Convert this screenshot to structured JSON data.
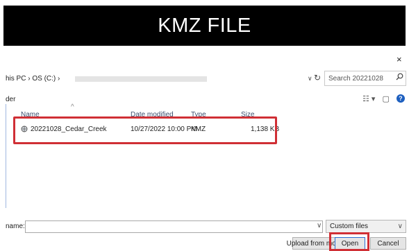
{
  "banner": {
    "title": "KMZ FILE"
  },
  "dialog": {
    "close_glyph": "×",
    "address_bar": {
      "path_text": "his PC › OS (C:) ›",
      "dropdown_glyph": "∨",
      "refresh_glyph": "↻"
    },
    "search": {
      "placeholder": "Search 20221028",
      "icon": "search-icon"
    },
    "folder_label": "der",
    "view_tools": {
      "view_glyph": "☷ ▾",
      "pane_glyph": "▢",
      "help_glyph": "?"
    },
    "columns": [
      "Name",
      "Date modified",
      "Type",
      "Size"
    ],
    "sort_caret": "^",
    "files": [
      {
        "name": "20221028_Cedar_Creek",
        "date_modified": "10/27/2022 10:00 PM",
        "type": "KMZ",
        "size": "1,138 KB",
        "icon": "kmz-file-icon"
      }
    ],
    "filename": {
      "label": "name:",
      "value": "",
      "chevron": "∨"
    },
    "file_type": {
      "selected": "Custom files",
      "chevron": "∨"
    },
    "buttons": {
      "upload": "Upload from mobile",
      "open": "Open",
      "cancel": "Cancel"
    },
    "highlight_color": "#d02f35"
  }
}
